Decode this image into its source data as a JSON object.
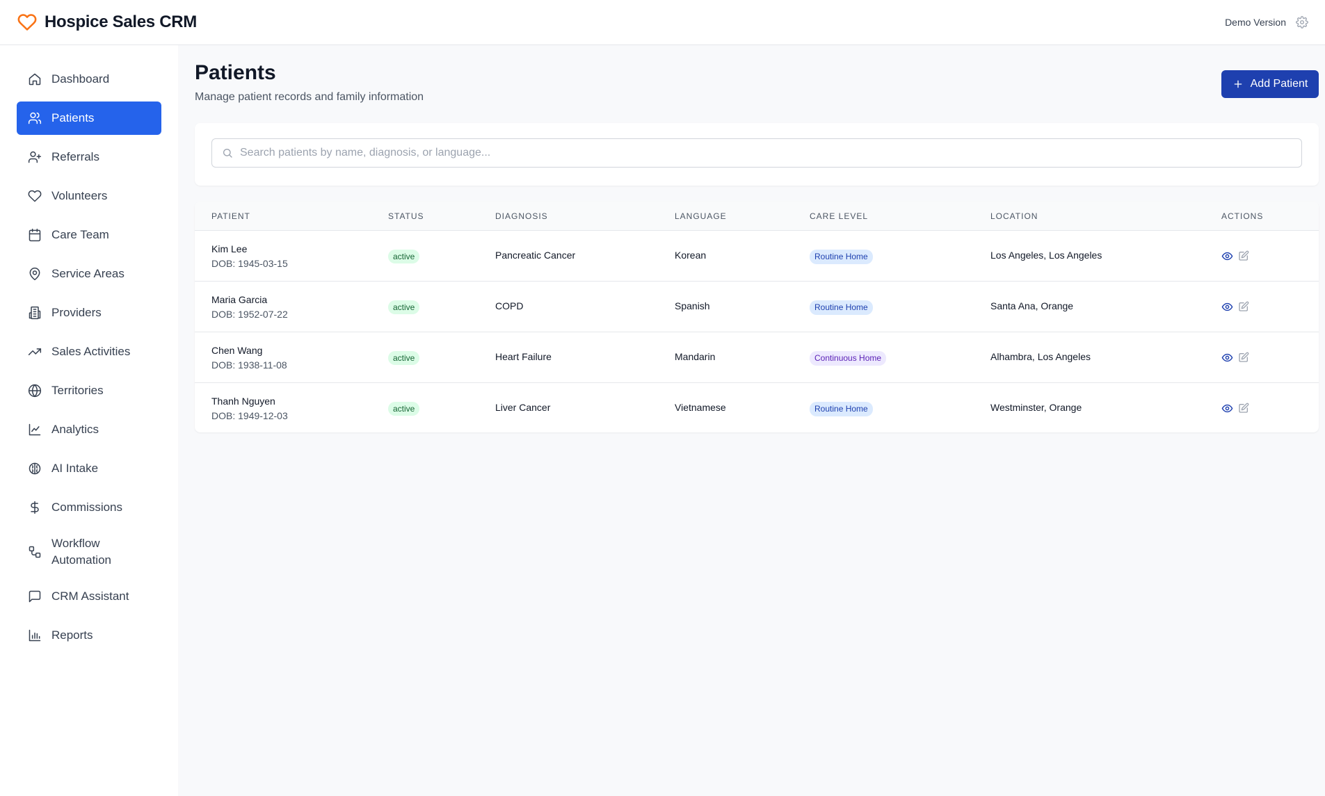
{
  "app": {
    "title": "Hospice Sales CRM",
    "demo_label": "Demo Version",
    "brand_color": "#f97316",
    "accent": "#2563eb"
  },
  "sidebar": {
    "items": [
      {
        "label": "Dashboard",
        "icon": "home-icon",
        "active": false
      },
      {
        "label": "Patients",
        "icon": "users-icon",
        "active": true
      },
      {
        "label": "Referrals",
        "icon": "user-plus-icon",
        "active": false
      },
      {
        "label": "Volunteers",
        "icon": "heart-icon",
        "active": false
      },
      {
        "label": "Care Team",
        "icon": "calendar-icon",
        "active": false
      },
      {
        "label": "Service Areas",
        "icon": "map-pin-icon",
        "active": false
      },
      {
        "label": "Providers",
        "icon": "building-icon",
        "active": false
      },
      {
        "label": "Sales Activities",
        "icon": "trending-up-icon",
        "active": false
      },
      {
        "label": "Territories",
        "icon": "globe-icon",
        "active": false
      },
      {
        "label": "Analytics",
        "icon": "line-chart-icon",
        "active": false
      },
      {
        "label": "AI Intake",
        "icon": "brain-icon",
        "active": false
      },
      {
        "label": "Commissions",
        "icon": "dollar-icon",
        "active": false
      },
      {
        "label": "Workflow Automation",
        "icon": "workflow-icon",
        "active": false
      },
      {
        "label": "CRM Assistant",
        "icon": "message-square-icon",
        "active": false
      },
      {
        "label": "Reports",
        "icon": "bar-chart-icon",
        "active": false
      }
    ]
  },
  "main": {
    "title": "Patients",
    "subtitle": "Manage patient records and family information",
    "add_button": "Add Patient",
    "search_placeholder": "Search patients by name, diagnosis, or language..."
  },
  "table": {
    "headers": [
      "PATIENT",
      "STATUS",
      "DIAGNOSIS",
      "LANGUAGE",
      "CARE LEVEL",
      "LOCATION",
      "ACTIONS"
    ],
    "rows": [
      {
        "name": "Kim Lee",
        "dob": "DOB: 1945-03-15",
        "status": "active",
        "diagnosis": "Pancreatic Cancer",
        "language": "Korean",
        "care_level": "Routine Home",
        "location": "Los Angeles, Los Angeles"
      },
      {
        "name": "Maria Garcia",
        "dob": "DOB: 1952-07-22",
        "status": "active",
        "diagnosis": "COPD",
        "language": "Spanish",
        "care_level": "Routine Home",
        "location": "Santa Ana, Orange"
      },
      {
        "name": "Chen Wang",
        "dob": "DOB: 1938-11-08",
        "status": "active",
        "diagnosis": "Heart Failure",
        "language": "Mandarin",
        "care_level": "Continuous Home",
        "location": "Alhambra, Los Angeles"
      },
      {
        "name": "Thanh Nguyen",
        "dob": "DOB: 1949-12-03",
        "status": "active",
        "diagnosis": "Liver Cancer",
        "language": "Vietnamese",
        "care_level": "Routine Home",
        "location": "Westminster, Orange"
      }
    ]
  }
}
